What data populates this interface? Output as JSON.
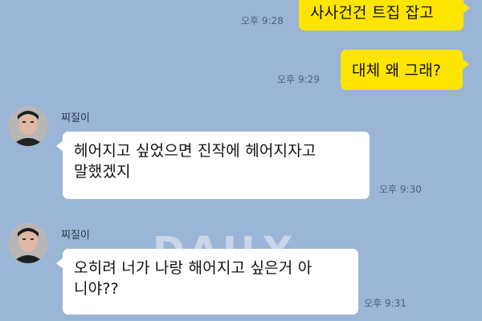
{
  "messages": [
    {
      "direction": "out",
      "text": "사사건건 트집 잡고",
      "time": "오후 9:28"
    },
    {
      "direction": "out",
      "text": "대체 왜 그래?",
      "time": "오후 9:29"
    },
    {
      "direction": "in",
      "sender": "찌질이",
      "text_lines": [
        "헤어지고 싶었으면 진작에 헤어지자고",
        "말했겠지"
      ],
      "time": "오후 9:30"
    },
    {
      "direction": "in",
      "sender": "찌질이",
      "text_lines": [
        "오히려 너가 나랑 해어지고 싶은거 아",
        "니야??"
      ],
      "time": "오후 9:31"
    }
  ],
  "watermark": "DAILY",
  "colors": {
    "background": "#9bb5d6",
    "outgoing_bubble": "#fee500",
    "incoming_bubble": "#ffffff"
  },
  "icons": {
    "avatar": "profile-photo"
  }
}
